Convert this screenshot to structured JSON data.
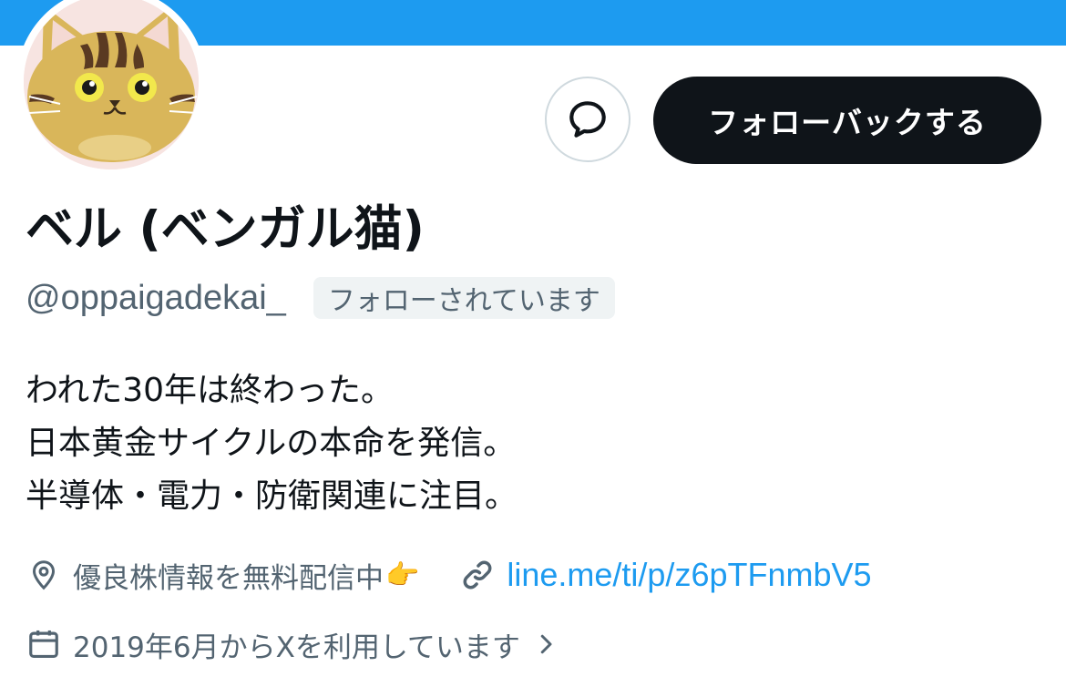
{
  "header": {
    "banner_color": "#1d9bf0"
  },
  "avatar": {
    "icon": "bengal-cat-avatar"
  },
  "actions": {
    "message_icon": "chat-bubble-icon",
    "follow_back_label": "フォローバックする"
  },
  "profile": {
    "name": "ベル (ベンガル猫)",
    "handle": "@oppaigadekai_",
    "follows_you_badge": "フォローされています",
    "bio_lines": [
      "われた30年は終わった。",
      "日本黄金サイクルの本命を発信。",
      "半導体・電力・防衛関連に注目。"
    ],
    "location": "優良株情報を無料配信中",
    "location_emoji": "👉",
    "link": "line.me/ti/p/z6pTFnmbV5",
    "joined": "2019年6月からXを利用しています"
  },
  "colors": {
    "text_primary": "#0f1419",
    "text_secondary": "#536471",
    "accent": "#1d9bf0",
    "button_dark": "#0f1419"
  }
}
